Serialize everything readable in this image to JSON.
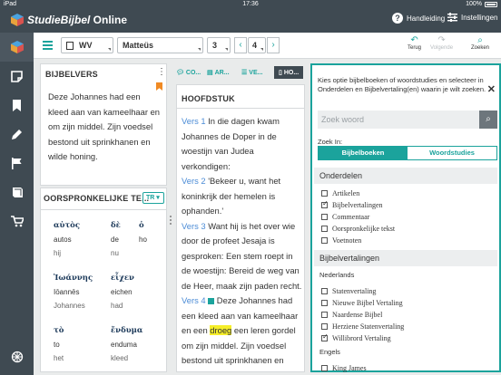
{
  "statusbar": {
    "device": "iPad",
    "time": "17:36",
    "battery": "100%"
  },
  "app": {
    "name_main": "StudieBijbel",
    "name_suffix": " Online",
    "help_label": "Handleiding",
    "settings_label": "Instellingen"
  },
  "rail": {
    "items": [
      "cube-icon",
      "note-icon",
      "bookmark-icon",
      "pencil-icon",
      "flag-icon",
      "book-icon",
      "cart-icon",
      "settings-wheel-icon"
    ]
  },
  "toolbar": {
    "translation": "WV",
    "book": "Matteüs",
    "chapter": "3",
    "verse": "4",
    "prev_label": "Terug",
    "next_label": "Volgende",
    "search_label": "Zoeken"
  },
  "bijbelvers": {
    "title": "BIJBELVERS",
    "text": "Deze Johannes had een kleed aan van kameelhaar en om zijn middel. Zijn voedsel bestond uit sprinkhanen en wilde honing."
  },
  "oorspronkelijk": {
    "title": "OORSPRONKELIJKE TE...",
    "lang_button": "TR",
    "words": [
      {
        "greek": "αὐτὸς",
        "translit": "autos",
        "dutch": "hij"
      },
      {
        "greek": "δὲ",
        "translit": "de",
        "dutch": "nu"
      },
      {
        "greek": "ὁ",
        "translit": "ho",
        "dutch": ""
      },
      {
        "greek": "Ἰωάννης",
        "translit": "Iōannēs",
        "dutch": "Johannes"
      },
      {
        "greek": "εἶχεν",
        "translit": "eichen",
        "dutch": "had"
      },
      {
        "greek": "τὸ",
        "translit": "to",
        "dutch": "het"
      },
      {
        "greek": "ἔνδυμα",
        "translit": "enduma",
        "dutch": "kleed"
      }
    ]
  },
  "tabs": [
    {
      "label": "CO...",
      "icon": "chat-icon"
    },
    {
      "label": "AR...",
      "icon": "document-icon"
    },
    {
      "label": "VE...",
      "icon": "list-icon"
    },
    {
      "label": "HO...",
      "icon": "page-icon"
    }
  ],
  "hoofdstuk": {
    "title": "HOOFDSTUK",
    "verses": [
      {
        "num": "Vers 1",
        "text": "In die dagen kwam Johannes de Doper in de woestijn van Judea verkondigen:"
      },
      {
        "num": "Vers 2",
        "text": "'Bekeer u, want het koninkrijk der hemelen is ophanden.'"
      },
      {
        "num": "Vers 3",
        "text": "Want hij is het over wie door de profeet Jesaja is gesproken: Een stem roept in de woestijn: Bereid de weg van de Heer, maak zijn paden recht."
      },
      {
        "num": "Vers 4",
        "text_a": "Deze Johannes had een kleed aan van kameelhaar en een",
        "highlight": "droeg",
        "text_b": "een leren gordel om zijn middel. Zijn voedsel bestond uit sprinkhanen en"
      }
    ]
  },
  "search_panel": {
    "intro": "Kies optie bijbelboeken of woordstudies en selecteer in Onderdelen en Bijbelvertaling(en) waarin je wilt zoeken.",
    "placeholder": "Zoek woord",
    "zoek_in": "Zoek In:",
    "seg_a": "Bijbelboeken",
    "seg_b": "Woordstudies",
    "onderdelen_title": "Onderdelen",
    "onderdelen": [
      {
        "label": "Artikelen",
        "checked": false
      },
      {
        "label": "Bijbelvertalingen",
        "checked": true
      },
      {
        "label": "Commentaar",
        "checked": false
      },
      {
        "label": "Oorspronkelijke tekst",
        "checked": false
      },
      {
        "label": "Voetnoten",
        "checked": false
      }
    ],
    "vertalingen_title": "Bijbelvertalingen",
    "nederlands": "Nederlands",
    "nl_items": [
      {
        "label": "Statenvertaling",
        "checked": false
      },
      {
        "label": "Nieuwe Bijbel Vertaling",
        "checked": false
      },
      {
        "label": "Naardense Bijbel",
        "checked": false
      },
      {
        "label": "Herziene Statenvertaling",
        "checked": false
      },
      {
        "label": "Willibrord Vertaling",
        "checked": true
      }
    ],
    "engels": "Engels",
    "en_items": [
      {
        "label": "King James",
        "checked": false
      }
    ]
  }
}
